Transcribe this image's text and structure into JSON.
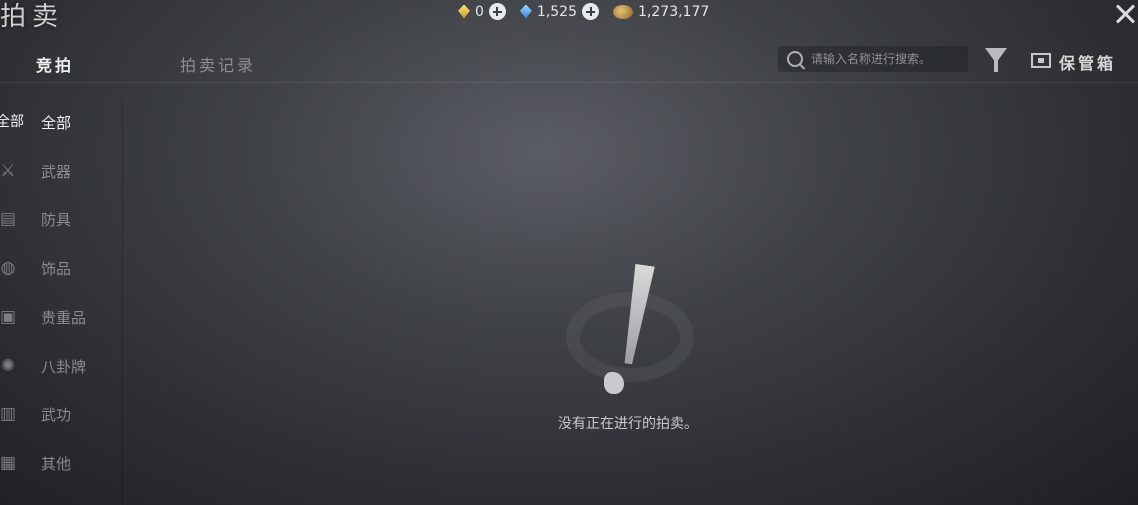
{
  "window": {
    "title": "拍卖"
  },
  "currencies": [
    {
      "icon": "gold-ingot-icon",
      "value": "0",
      "color": "#e8b53a",
      "has_plus": true
    },
    {
      "icon": "blue-crystal-icon",
      "value": "1,525",
      "color": "#4aa3f0",
      "has_plus": true
    },
    {
      "icon": "copper-coin-icon",
      "value": "1,273,177",
      "color": "#c99a48",
      "has_plus": false
    }
  ],
  "tabs": [
    {
      "label": "竞拍",
      "active": true
    },
    {
      "label": "拍卖记录",
      "active": false
    }
  ],
  "search": {
    "placeholder": "请输入名称进行搜索。"
  },
  "toolbar": {
    "storage_label": "保管箱"
  },
  "categories": [
    {
      "label": "全部",
      "icon": "all-icon",
      "icon_text": "全部",
      "active": true
    },
    {
      "label": "武器",
      "icon": "weapon-icon"
    },
    {
      "label": "防具",
      "icon": "armor-icon"
    },
    {
      "label": "饰品",
      "icon": "accessory-icon"
    },
    {
      "label": "贵重品",
      "icon": "valuables-icon"
    },
    {
      "label": "八卦牌",
      "icon": "bagua-icon"
    },
    {
      "label": "武功",
      "icon": "martial-arts-icon"
    },
    {
      "label": "其他",
      "icon": "other-icon"
    }
  ],
  "empty_state": {
    "message": "没有正在进行的拍卖。"
  }
}
